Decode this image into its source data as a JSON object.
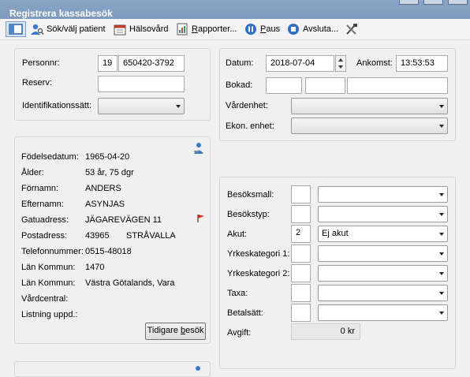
{
  "window": {
    "title": "Registrera kassabesök"
  },
  "toolbar": {
    "items": [
      {
        "label": "Sök/välj patient",
        "icon": "patient-search-icon"
      },
      {
        "label": "Hälsovård",
        "icon": "calendar-icon"
      },
      {
        "label": "Rapporter...",
        "icon": "report-icon"
      },
      {
        "label": "Paus",
        "icon": "pause-icon"
      },
      {
        "label": "Avsluta...",
        "icon": "stop-icon"
      }
    ]
  },
  "patient_search": {
    "personnr_label": "Personnr:",
    "personnr_century": "19",
    "personnr_value": "650420-3792",
    "reserv_label": "Reserv:",
    "reserv_value": "",
    "ident_label": "Identifikationssätt:",
    "ident_value": ""
  },
  "visit": {
    "datum_label": "Datum:",
    "datum_value": "2018-07-04",
    "ankomst_label": "Ankomst:",
    "ankomst_value": "13:53:53",
    "bokad_label": "Bokad:",
    "vardenhet_label": "Vårdenhet:",
    "ekon_label": "Ekon. enhet:"
  },
  "patient_info": {
    "fodelsedatum_label": "Födelsedatum:",
    "fodelsedatum": "1965-04-20",
    "alder_label": "Ålder:",
    "alder": "53 år, 75 dgr",
    "fornamn_label": "Förnamn:",
    "fornamn": "ANDERS",
    "efternamn_label": "Efternamn:",
    "efternamn": "ASYNJAS",
    "gatuadress_label": "Gatuadress:",
    "gatuadress": "JÄGAREVÄGEN 11",
    "postadress_label": "Postadress:",
    "postnummer": "43965",
    "postort": "STRÅVALLA",
    "telefon_label": "Telefonnummer:",
    "telefon": "0515-48018",
    "lan_kommun_label_1": "Län Kommun:",
    "lan_kommun_1": "1470",
    "lan_kommun_label_2": "Län Kommun:",
    "lan_kommun_2": "Västra Götalands, Vara",
    "vardcentral_label": "Vårdcentral:",
    "vardcentral": "",
    "listning_label": "Listning uppd.:",
    "listning": "",
    "tidigare_besok_prefix": "Tidigare ",
    "tidigare_besok_underlined": "b",
    "tidigare_besok_suffix": "esök"
  },
  "billing": {
    "besoksmall_label": "Besöksmall:",
    "besokstyp_label": "Besökstyp:",
    "akut_label": "Akut:",
    "akut_code": "2",
    "akut_value": "Ej akut",
    "yrkeskategori1_label": "Yrkeskategori 1:",
    "yrkeskategori2_label": "Yrkeskategori 2:",
    "taxa_label": "Taxa:",
    "betalsatt_label": "Betalsätt:",
    "avgift_label": "Avgift:",
    "avgift_value": "0 kr"
  }
}
